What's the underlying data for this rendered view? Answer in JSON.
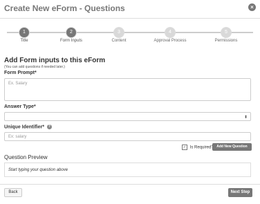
{
  "header": {
    "title": "Create New eForm - Questions",
    "close_icon": "close-circle-icon"
  },
  "stepper": {
    "steps": [
      {
        "number": "1",
        "label": "Title",
        "state": "active"
      },
      {
        "number": "2",
        "label": "Form Inputs",
        "state": "active"
      },
      {
        "number": "3",
        "label": "Content",
        "state": "inactive"
      },
      {
        "number": "4",
        "label": "Approval Process",
        "state": "inactive"
      },
      {
        "number": "5",
        "label": "Permissions",
        "state": "inactive"
      }
    ]
  },
  "form": {
    "section_title": "Add Form inputs to this eForm",
    "hint": "(You can add questions if needed later.)",
    "prompt_label": "Form Prompt*",
    "prompt_placeholder": "Ex. Salary",
    "answer_type_label": "Answer Type*",
    "answer_type_value": "",
    "identifier_label": "Unique Identifier*",
    "identifier_placeholder": "Ex: salary",
    "required_label": "Is Required?",
    "required_checked": true,
    "add_button": "Add New Question"
  },
  "preview": {
    "title": "Question Preview",
    "placeholder": "Start typing your question above"
  },
  "footer": {
    "back": "Back",
    "next": "Next Step"
  },
  "colors": {
    "accent": "#777777",
    "border": "#cccccc"
  }
}
